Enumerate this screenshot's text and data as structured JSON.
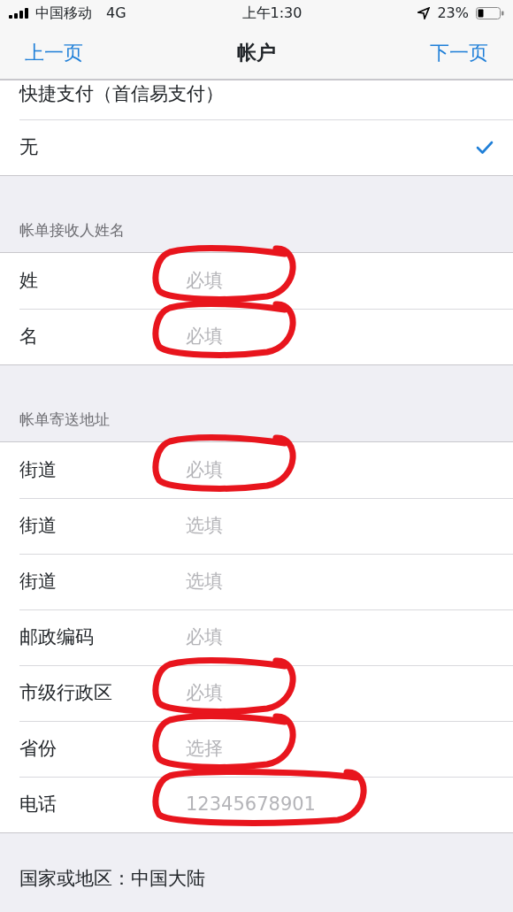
{
  "status_bar": {
    "carrier": "中国移动",
    "network": "4G",
    "time": "上午1:30",
    "battery": "23%"
  },
  "nav": {
    "back": "上一页",
    "title": "帐户",
    "next": "下一页"
  },
  "payment_options": [
    {
      "label": "快捷支付（首信易支付）",
      "selected": false
    },
    {
      "label": "无",
      "selected": true
    }
  ],
  "sections": [
    {
      "header": "帐单接收人姓名",
      "fields": [
        {
          "label": "姓",
          "placeholder": "必填",
          "circled": true
        },
        {
          "label": "名",
          "placeholder": "必填",
          "circled": true
        }
      ]
    },
    {
      "header": "帐单寄送地址",
      "fields": [
        {
          "label": "街道",
          "placeholder": "必填",
          "circled": true
        },
        {
          "label": "街道",
          "placeholder": "选填",
          "circled": false
        },
        {
          "label": "街道",
          "placeholder": "选填",
          "circled": false
        },
        {
          "label": "邮政编码",
          "placeholder": "必填",
          "circled": false
        },
        {
          "label": "市级行政区",
          "placeholder": "必填",
          "circled": true
        },
        {
          "label": "省份",
          "placeholder": "选择",
          "circled": true
        },
        {
          "label": "电话",
          "placeholder": "12345678901",
          "circled": true
        }
      ]
    }
  ],
  "footer": "国家或地区：中国大陆"
}
